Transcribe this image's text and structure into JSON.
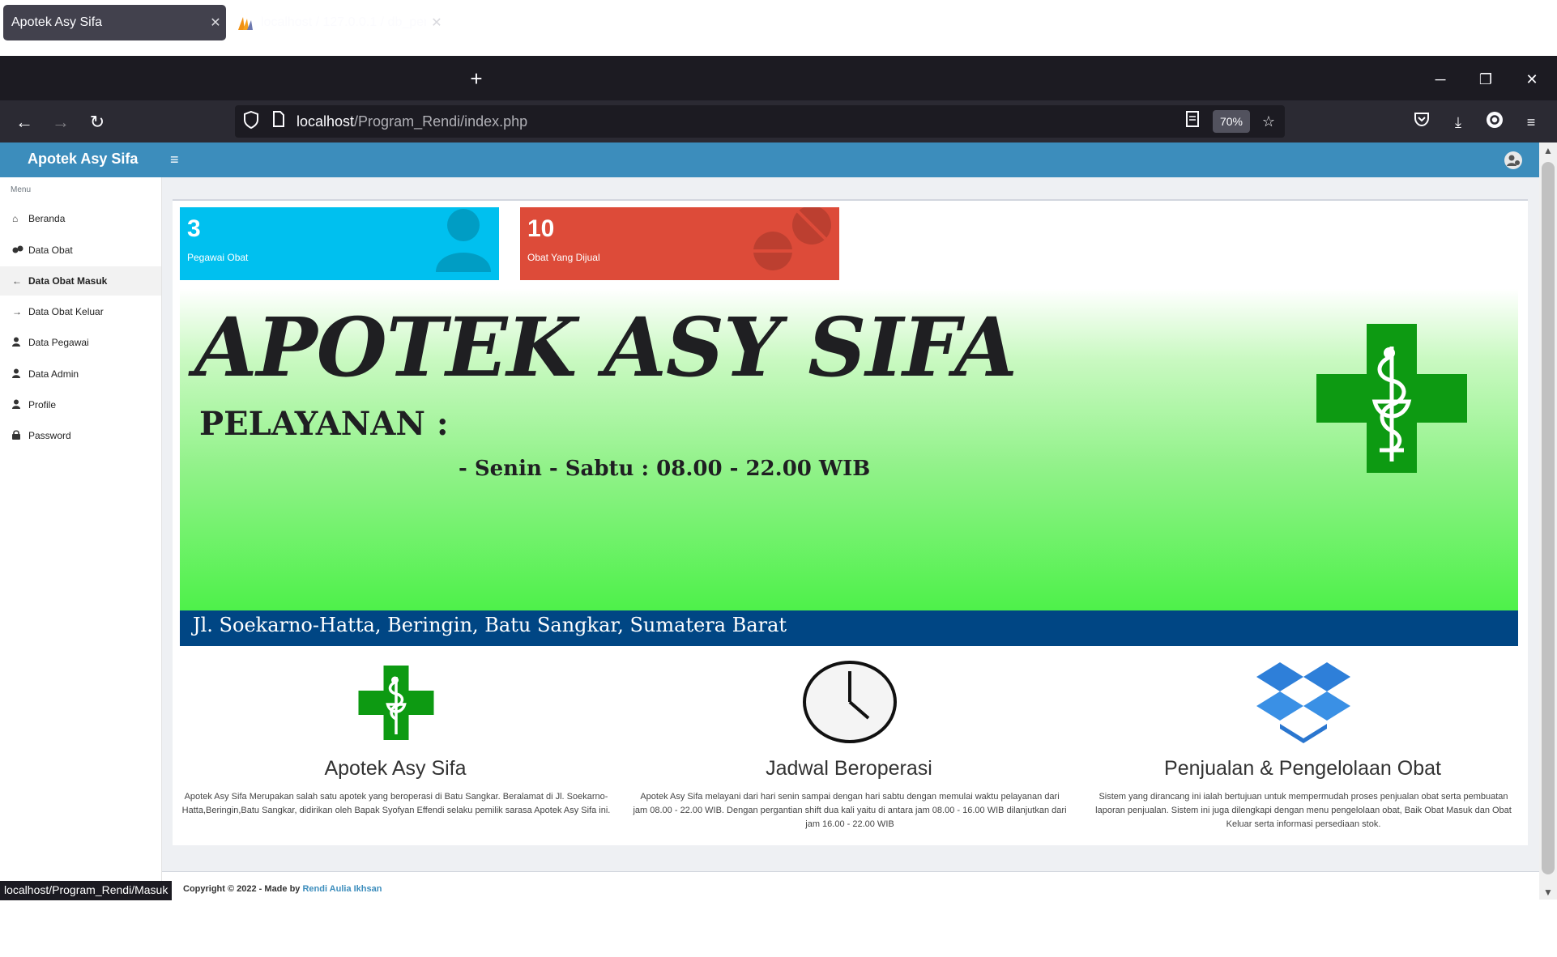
{
  "browser": {
    "tabs": [
      {
        "title": "Apotek Asy Sifa",
        "active": true
      },
      {
        "title": "localhost / 127.0.0.1 / db_penju",
        "active": false
      }
    ],
    "new_tab_label": "+",
    "url_host": "localhost",
    "url_path": "/Program_Rendi/index.php",
    "zoom": "70%",
    "status_link": "localhost/Program_Rendi/Masuk"
  },
  "app": {
    "brand": "Apotek Asy Sifa",
    "hamburger": "≡",
    "sidebar": {
      "header": "Menu",
      "items": [
        {
          "label": "Beranda",
          "icon": "home-icon",
          "active": false
        },
        {
          "label": "Data Obat",
          "icon": "pills-icon",
          "active": false
        },
        {
          "label": "Data Obat Masuk",
          "icon": "arrow-left-icon",
          "active": true
        },
        {
          "label": "Data Obat Keluar",
          "icon": "arrow-right-icon",
          "active": false
        },
        {
          "label": "Data Pegawai",
          "icon": "user-icon",
          "active": false
        },
        {
          "label": "Data Admin",
          "icon": "user-icon",
          "active": false
        },
        {
          "label": "Profile",
          "icon": "user-icon",
          "active": false
        },
        {
          "label": "Password",
          "icon": "lock-icon",
          "active": false
        }
      ]
    },
    "stats": [
      {
        "value": "3",
        "label": "Pegawai Obat",
        "color": "#00c0ef",
        "icon": "user-icon"
      },
      {
        "value": "10",
        "label": "Obat Yang Dijual",
        "color": "#dd4b39",
        "icon": "pills-icon"
      }
    ],
    "banner": {
      "title": "APOTEK ASY SIFA",
      "service_heading": "PELAYANAN :",
      "hours": "- Senin - Sabtu : 08.00 - 22.00 WIB",
      "address": "Jl. Soekarno-Hatta, Beringin, Batu Sangkar, Sumatera Barat"
    },
    "features": [
      {
        "title": "Apotek Asy Sifa",
        "icon": "pharmacy-cross-icon",
        "text": "Apotek Asy Sifa Merupakan salah satu apotek yang beroperasi di Batu Sangkar. Beralamat di Jl. Soekarno-Hatta,Beringin,Batu Sangkar, didirikan oleh Bapak Syofyan Effendi selaku pemilik sarasa Apotek Asy Sifa ini."
      },
      {
        "title": "Jadwal Beroperasi",
        "icon": "clock-icon",
        "text": "Apotek Asy Sifa melayani dari hari senin sampai dengan hari sabtu dengan memulai waktu pelayanan dari jam 08.00 - 22.00 WIB. Dengan pergantian shift dua kali yaitu di antara jam 08.00 - 16.00 WIB dilanjutkan dari jam 16.00 - 22.00 WIB"
      },
      {
        "title": "Penjualan & Pengelolaan Obat",
        "icon": "box-icon",
        "text": "Sistem yang dirancang ini ialah bertujuan untuk mempermudah proses penjualan obat serta pembuatan laporan penjualan. Sistem ini juga dilengkapi dengan menu pengelolaan obat, Baik Obat Masuk dan Obat Keluar serta informasi persediaan stok."
      }
    ],
    "footer": {
      "prefix": "Copyright © 2022 - Made by ",
      "author": "Rendi Aulia Ikhsan"
    }
  }
}
